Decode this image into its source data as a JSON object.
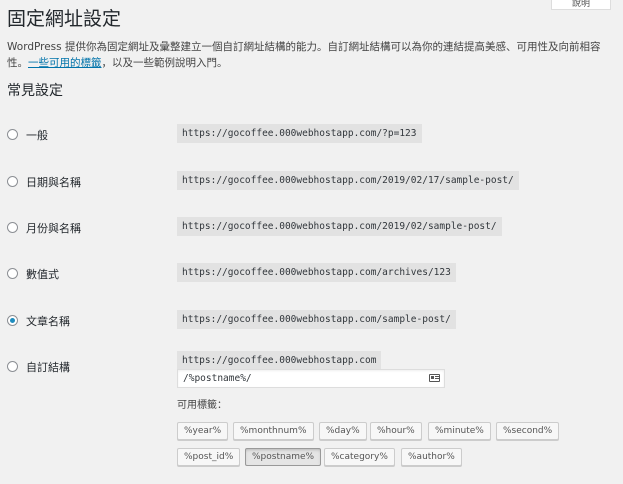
{
  "help_tab": "說明",
  "page_title": "固定網址設定",
  "intro": {
    "text": "WordPress 提供你為固定網址及彙整建立一個自訂網址結構的能力。自訂網址結構可以為你的連結提高美感、可用性及向前相容性。",
    "link": "一些可用的標籤",
    "suffix": "，以及一些範例說明入門。"
  },
  "section_title": "常見設定",
  "options": [
    {
      "label": "一般",
      "url": "https://gocoffee.000webhostapp.com/?p=123",
      "checked": false
    },
    {
      "label": "日期與名稱",
      "url": "https://gocoffee.000webhostapp.com/2019/02/17/sample-post/",
      "checked": false
    },
    {
      "label": "月份與名稱",
      "url": "https://gocoffee.000webhostapp.com/2019/02/sample-post/",
      "checked": false
    },
    {
      "label": "數值式",
      "url": "https://gocoffee.000webhostapp.com/archives/123",
      "checked": false
    },
    {
      "label": "文章名稱",
      "url": "https://gocoffee.000webhostapp.com/sample-post/",
      "checked": true
    }
  ],
  "custom": {
    "label": "自訂結構",
    "base_url": "https://gocoffee.000webhostapp.com",
    "input_value": "/%postname%/",
    "checked": false
  },
  "tags_label": "可用標籤：",
  "tags": [
    {
      "label": "%year%",
      "active": false
    },
    {
      "label": "%monthnum%",
      "active": false
    },
    {
      "label": "%day%",
      "active": false
    },
    {
      "label": "%hour%",
      "active": false
    },
    {
      "label": "%minute%",
      "active": false
    },
    {
      "label": "%second%",
      "active": false
    },
    {
      "label": "%post_id%",
      "active": false
    },
    {
      "label": "%postname%",
      "active": true
    },
    {
      "label": "%category%",
      "active": false
    },
    {
      "label": "%author%",
      "active": false
    }
  ],
  "colors": {
    "accent": "#1e8cbe",
    "link": "#0073aa",
    "background": "#f1f1f1"
  }
}
